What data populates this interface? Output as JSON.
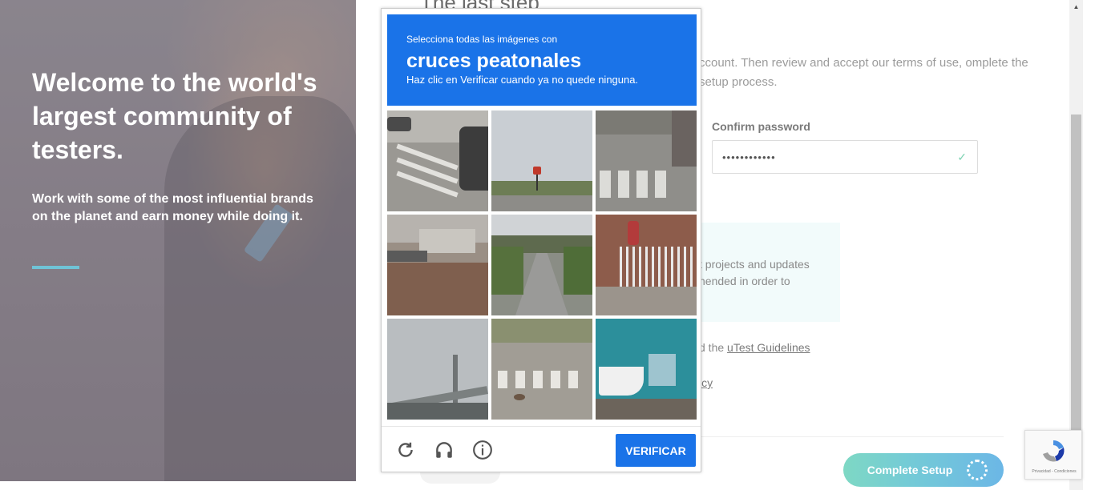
{
  "hero": {
    "title": "Welcome to the world's largest community of testers.",
    "subtitle": "Work with some of the most influential brands on the planet and earn money while doing it."
  },
  "form": {
    "heading_partial": "The last step",
    "intro_partial": "ccount. Then review and accept our terms of use, omplete the setup process.",
    "confirm_password_label": "Confirm password",
    "confirm_password_value": "••••••••••••",
    "info_text_partial": "t projects and updates nended in order to",
    "guidelines_prefix": "d the ",
    "guidelines_link": "uTest Guidelines",
    "privacy_partial": "icy",
    "complete_button": "Complete Setup"
  },
  "captcha": {
    "instruction": "Selecciona todas las imágenes con",
    "keyword": "cruces peatonales",
    "hint": "Haz clic en Verificar cuando ya no quede ninguna.",
    "verify_label": "VERIFICAR",
    "tiles": [
      {
        "scene": "crosswalk-street-corner"
      },
      {
        "scene": "road-traffic-light"
      },
      {
        "scene": "crosswalk-bike-lane"
      },
      {
        "scene": "storefront-sign"
      },
      {
        "scene": "road-underpass"
      },
      {
        "scene": "house-fence"
      },
      {
        "scene": "bridge-structure"
      },
      {
        "scene": "crosswalk-intersection"
      },
      {
        "scene": "boat-house"
      }
    ],
    "icons": [
      "reload-icon",
      "audio-icon",
      "info-icon"
    ]
  },
  "badge": {
    "text": "Privacidad - Condiciones"
  },
  "colors": {
    "captcha_blue": "#1a73e8",
    "accent_teal": "#6fc3d6",
    "button_gradient_start": "#7ed8c4",
    "button_gradient_end": "#6cb7e6"
  }
}
